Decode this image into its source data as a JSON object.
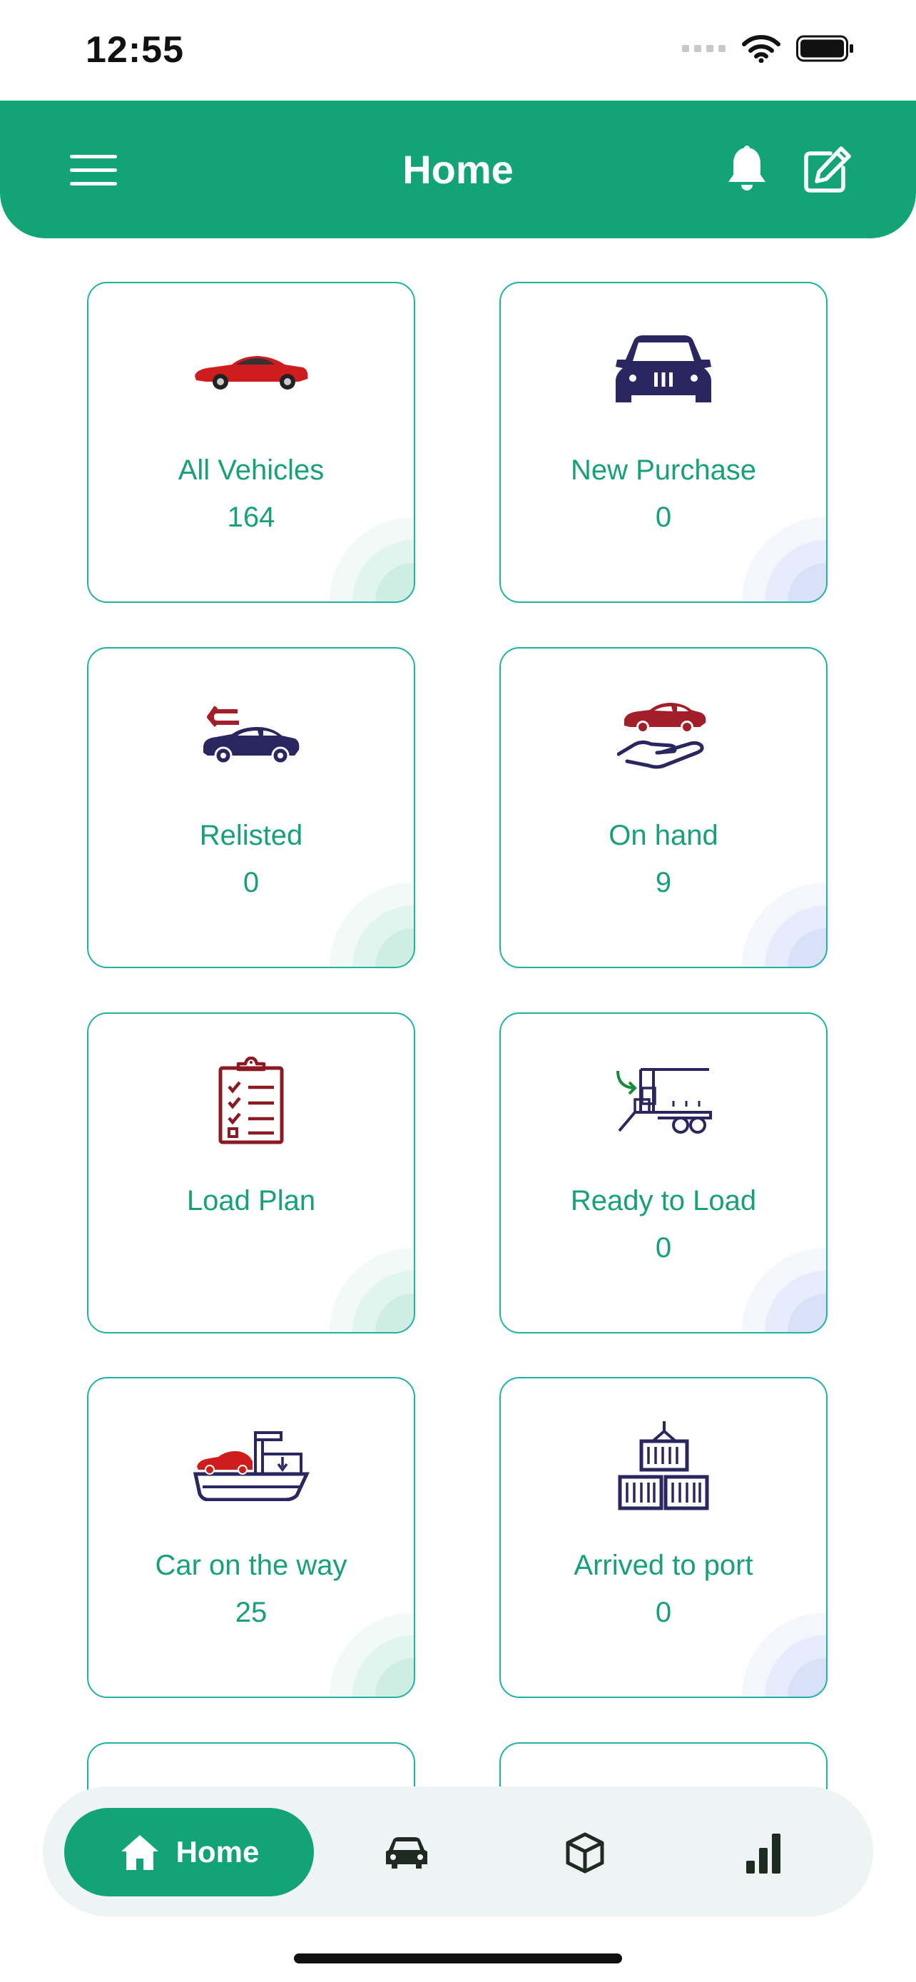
{
  "status": {
    "time": "12:55"
  },
  "header": {
    "title": "Home"
  },
  "cards": [
    {
      "label": "All Vehicles",
      "count": "164",
      "icon": "sports-car-icon"
    },
    {
      "label": "New Purchase",
      "count": "0",
      "icon": "car-front-icon"
    },
    {
      "label": "Relisted",
      "count": "0",
      "icon": "car-return-icon"
    },
    {
      "label": "On hand",
      "count": "9",
      "icon": "car-in-hand-icon"
    },
    {
      "label": "Load Plan",
      "count": "",
      "icon": "clipboard-checklist-icon"
    },
    {
      "label": "Ready to Load",
      "count": "0",
      "icon": "loading-truck-icon"
    },
    {
      "label": "Car on the way",
      "count": "25",
      "icon": "cargo-ship-icon"
    },
    {
      "label": "Arrived to port",
      "count": "0",
      "icon": "containers-icon"
    }
  ],
  "bottom_nav": {
    "items": [
      {
        "label": "Home",
        "icon": "home-icon",
        "active": true
      },
      {
        "label": "",
        "icon": "car-icon",
        "active": false
      },
      {
        "label": "",
        "icon": "box-icon",
        "active": false
      },
      {
        "label": "",
        "icon": "bar-chart-icon",
        "active": false
      }
    ]
  },
  "colors": {
    "primary": "#12a476",
    "card_border": "#1fb3a4",
    "text_green": "#17a07a",
    "navy": "#2a2660",
    "maroon": "#8b1a24"
  }
}
